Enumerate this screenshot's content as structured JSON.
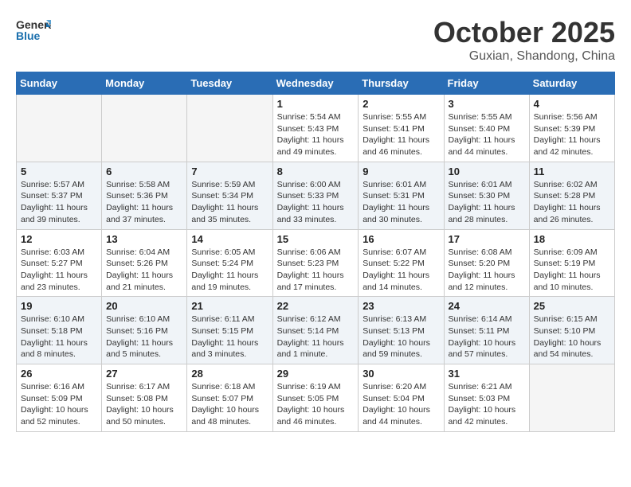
{
  "header": {
    "logo_general": "General",
    "logo_blue": "Blue",
    "month": "October 2025",
    "location": "Guxian, Shandong, China"
  },
  "weekdays": [
    "Sunday",
    "Monday",
    "Tuesday",
    "Wednesday",
    "Thursday",
    "Friday",
    "Saturday"
  ],
  "weeks": [
    [
      {
        "day": "",
        "info": ""
      },
      {
        "day": "",
        "info": ""
      },
      {
        "day": "",
        "info": ""
      },
      {
        "day": "1",
        "info": "Sunrise: 5:54 AM\nSunset: 5:43 PM\nDaylight: 11 hours\nand 49 minutes."
      },
      {
        "day": "2",
        "info": "Sunrise: 5:55 AM\nSunset: 5:41 PM\nDaylight: 11 hours\nand 46 minutes."
      },
      {
        "day": "3",
        "info": "Sunrise: 5:55 AM\nSunset: 5:40 PM\nDaylight: 11 hours\nand 44 minutes."
      },
      {
        "day": "4",
        "info": "Sunrise: 5:56 AM\nSunset: 5:39 PM\nDaylight: 11 hours\nand 42 minutes."
      }
    ],
    [
      {
        "day": "5",
        "info": "Sunrise: 5:57 AM\nSunset: 5:37 PM\nDaylight: 11 hours\nand 39 minutes."
      },
      {
        "day": "6",
        "info": "Sunrise: 5:58 AM\nSunset: 5:36 PM\nDaylight: 11 hours\nand 37 minutes."
      },
      {
        "day": "7",
        "info": "Sunrise: 5:59 AM\nSunset: 5:34 PM\nDaylight: 11 hours\nand 35 minutes."
      },
      {
        "day": "8",
        "info": "Sunrise: 6:00 AM\nSunset: 5:33 PM\nDaylight: 11 hours\nand 33 minutes."
      },
      {
        "day": "9",
        "info": "Sunrise: 6:01 AM\nSunset: 5:31 PM\nDaylight: 11 hours\nand 30 minutes."
      },
      {
        "day": "10",
        "info": "Sunrise: 6:01 AM\nSunset: 5:30 PM\nDaylight: 11 hours\nand 28 minutes."
      },
      {
        "day": "11",
        "info": "Sunrise: 6:02 AM\nSunset: 5:28 PM\nDaylight: 11 hours\nand 26 minutes."
      }
    ],
    [
      {
        "day": "12",
        "info": "Sunrise: 6:03 AM\nSunset: 5:27 PM\nDaylight: 11 hours\nand 23 minutes."
      },
      {
        "day": "13",
        "info": "Sunrise: 6:04 AM\nSunset: 5:26 PM\nDaylight: 11 hours\nand 21 minutes."
      },
      {
        "day": "14",
        "info": "Sunrise: 6:05 AM\nSunset: 5:24 PM\nDaylight: 11 hours\nand 19 minutes."
      },
      {
        "day": "15",
        "info": "Sunrise: 6:06 AM\nSunset: 5:23 PM\nDaylight: 11 hours\nand 17 minutes."
      },
      {
        "day": "16",
        "info": "Sunrise: 6:07 AM\nSunset: 5:22 PM\nDaylight: 11 hours\nand 14 minutes."
      },
      {
        "day": "17",
        "info": "Sunrise: 6:08 AM\nSunset: 5:20 PM\nDaylight: 11 hours\nand 12 minutes."
      },
      {
        "day": "18",
        "info": "Sunrise: 6:09 AM\nSunset: 5:19 PM\nDaylight: 11 hours\nand 10 minutes."
      }
    ],
    [
      {
        "day": "19",
        "info": "Sunrise: 6:10 AM\nSunset: 5:18 PM\nDaylight: 11 hours\nand 8 minutes."
      },
      {
        "day": "20",
        "info": "Sunrise: 6:10 AM\nSunset: 5:16 PM\nDaylight: 11 hours\nand 5 minutes."
      },
      {
        "day": "21",
        "info": "Sunrise: 6:11 AM\nSunset: 5:15 PM\nDaylight: 11 hours\nand 3 minutes."
      },
      {
        "day": "22",
        "info": "Sunrise: 6:12 AM\nSunset: 5:14 PM\nDaylight: 11 hours\nand 1 minute."
      },
      {
        "day": "23",
        "info": "Sunrise: 6:13 AM\nSunset: 5:13 PM\nDaylight: 10 hours\nand 59 minutes."
      },
      {
        "day": "24",
        "info": "Sunrise: 6:14 AM\nSunset: 5:11 PM\nDaylight: 10 hours\nand 57 minutes."
      },
      {
        "day": "25",
        "info": "Sunrise: 6:15 AM\nSunset: 5:10 PM\nDaylight: 10 hours\nand 54 minutes."
      }
    ],
    [
      {
        "day": "26",
        "info": "Sunrise: 6:16 AM\nSunset: 5:09 PM\nDaylight: 10 hours\nand 52 minutes."
      },
      {
        "day": "27",
        "info": "Sunrise: 6:17 AM\nSunset: 5:08 PM\nDaylight: 10 hours\nand 50 minutes."
      },
      {
        "day": "28",
        "info": "Sunrise: 6:18 AM\nSunset: 5:07 PM\nDaylight: 10 hours\nand 48 minutes."
      },
      {
        "day": "29",
        "info": "Sunrise: 6:19 AM\nSunset: 5:05 PM\nDaylight: 10 hours\nand 46 minutes."
      },
      {
        "day": "30",
        "info": "Sunrise: 6:20 AM\nSunset: 5:04 PM\nDaylight: 10 hours\nand 44 minutes."
      },
      {
        "day": "31",
        "info": "Sunrise: 6:21 AM\nSunset: 5:03 PM\nDaylight: 10 hours\nand 42 minutes."
      },
      {
        "day": "",
        "info": ""
      }
    ]
  ]
}
